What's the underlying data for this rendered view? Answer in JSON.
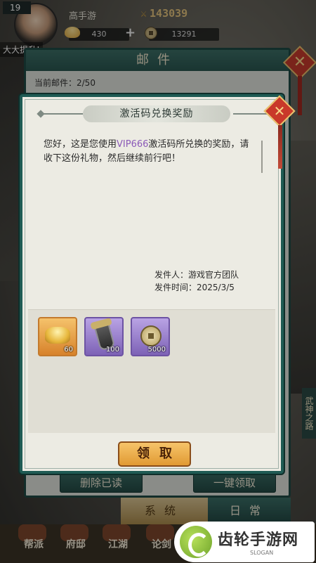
{
  "hud": {
    "level": "19",
    "player_name": "高手游",
    "power": "143039",
    "gold": "430",
    "coins": "13291",
    "ticker": "大大提升!"
  },
  "mail": {
    "title": "邮件",
    "count_label": "当前邮件：2/50",
    "delete_read": "删除已读",
    "claim_all": "一键领取",
    "tab_system": "系统",
    "tab_daily": "日常"
  },
  "dialog": {
    "title": "激活码兑换奖励",
    "message_prefix": "您好，这是您使用",
    "message_code": "VIP666",
    "message_suffix": "激活码所兑换的奖励，请收下这份礼物，然后继续前行吧！",
    "sender_line": "发件人：游戏官方团队",
    "time_line": "发件时间：2025/3/5",
    "claim_label": "领取",
    "close_symbol": "✕"
  },
  "rewards": [
    {
      "icon": "gold-ingot-icon",
      "qty": "60"
    },
    {
      "icon": "token-icon",
      "qty": "100"
    },
    {
      "icon": "copper-coin-icon",
      "qty": "5000"
    }
  ],
  "nav": {
    "items": [
      "帮派",
      "府邸",
      "江湖",
      "论剑"
    ]
  },
  "side_label": "武神之路",
  "watermark": {
    "title": "齿轮手游网",
    "subtitle": "SLOGAN"
  },
  "colors": {
    "teal": "#1f5b54",
    "vip_purple": "#8b5ab8",
    "claim_orange": "#e19a33",
    "close_red": "#c9392a"
  }
}
